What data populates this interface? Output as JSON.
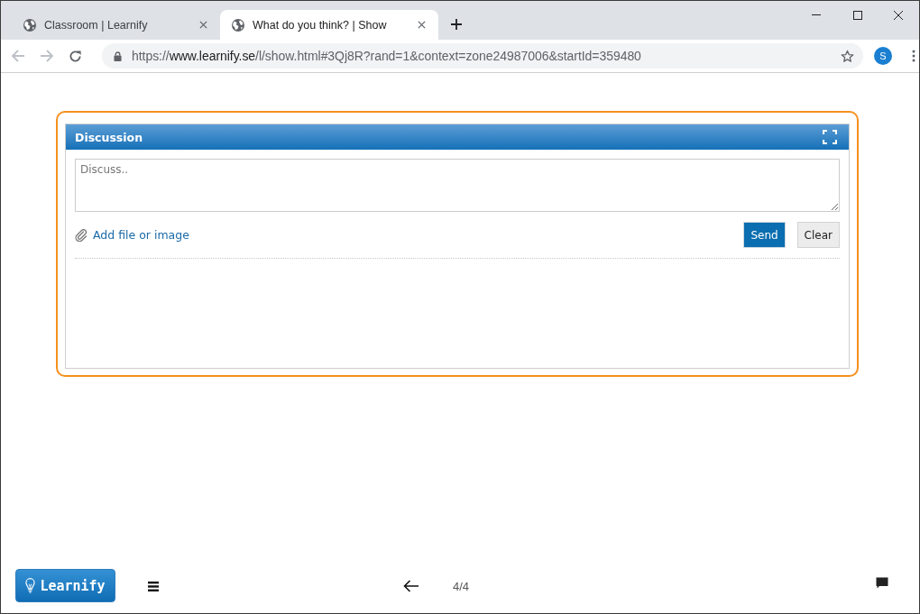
{
  "browser": {
    "tabs": [
      {
        "title": "Classroom | Learnify",
        "selected": false
      },
      {
        "title": "What do you think? | Show",
        "selected": true
      }
    ],
    "address_bar": {
      "scheme": "https://",
      "host": "www.learnify.se",
      "path": "/l/show.html#3Qj8R?rand=1&context=zone24987006&startId=359480"
    },
    "profile_initial": "S"
  },
  "discussion": {
    "title": "Discussion",
    "input": {
      "placeholder": "Discuss.."
    },
    "attach_link": "Add file or image",
    "buttons": [
      {
        "label": "Send",
        "kind": "primary"
      },
      {
        "label": "Clear",
        "kind": "secondary"
      }
    ]
  },
  "footer": {
    "logo": "Learnify",
    "page": "4/4"
  }
}
